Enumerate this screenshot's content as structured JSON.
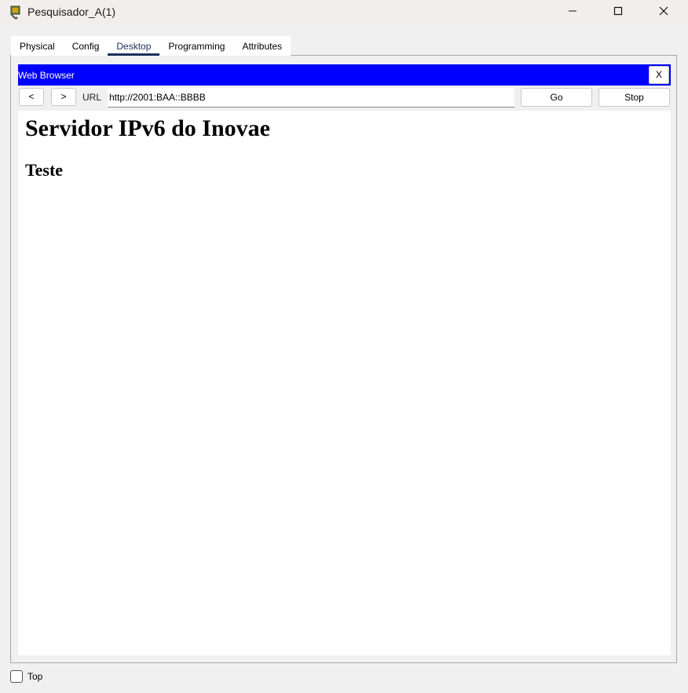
{
  "window": {
    "title": "Pesquisador_A(1)",
    "icon": "packet-tracer-pc-icon",
    "controls": [
      "minimize-icon",
      "maximize-icon",
      "close-icon"
    ]
  },
  "tabs": [
    {
      "label": "Physical",
      "active": false
    },
    {
      "label": "Config",
      "active": false
    },
    {
      "label": "Desktop",
      "active": true
    },
    {
      "label": "Programming",
      "active": false
    },
    {
      "label": "Attributes",
      "active": false
    }
  ],
  "browser": {
    "title": "Web Browser",
    "close_label": "X",
    "back_label": "<",
    "forward_label": ">",
    "url_label": "URL",
    "url_value": "http://2001:BAA::BBBB",
    "go_label": "Go",
    "stop_label": "Stop",
    "accent_color": "#0000ff"
  },
  "page": {
    "heading": "Servidor IPv6 do Inovae",
    "subheading": "Teste"
  },
  "footer": {
    "top_label": "Top",
    "top_checked": false
  }
}
